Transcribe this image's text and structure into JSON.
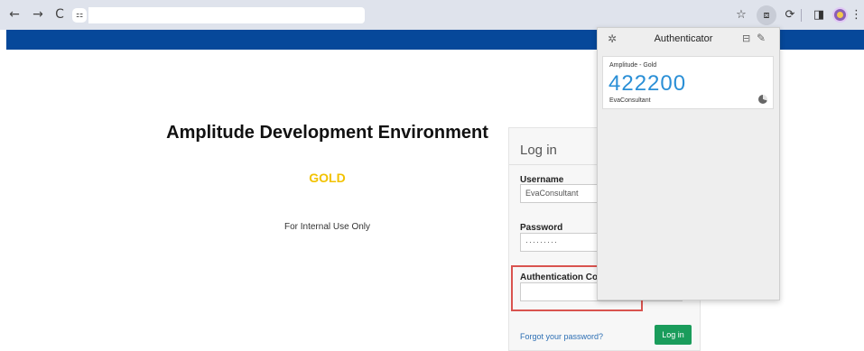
{
  "browser": {
    "back_icon": "←",
    "forward_icon": "→",
    "reload_icon": "C",
    "site_info_icon": "⚏",
    "bookmark_icon": "☆",
    "ext_icon": "⧈",
    "puzzle_icon": "⟳",
    "sidepanel_icon": "◨",
    "menu_icon": "⋮"
  },
  "page": {
    "title": "Amplitude Development Environment",
    "environment": "GOLD",
    "note": "For Internal Use Only"
  },
  "login": {
    "heading": "Log in",
    "username_label": "Username",
    "username_value": "EvaConsultant",
    "password_label": "Password",
    "password_value": "·········",
    "auth_code_label": "Authentication Code",
    "auth_code_value": "",
    "forgot_link": "Forgot your password?",
    "submit_label": "Log in"
  },
  "authenticator": {
    "title": "Authenticator",
    "gear_icon": "✲",
    "scan_icon": "⊟",
    "pencil_icon": "✎",
    "entry": {
      "issuer": "Amplitude - Gold",
      "code": "422200",
      "account": "EvaConsultant",
      "timer_remaining_fraction": 0.3
    }
  },
  "colors": {
    "header_blue": "#06489a",
    "gold": "#f2c200",
    "code_blue": "#2a8fd6",
    "login_green": "#1a9c5b",
    "highlight_red": "#d9534f"
  }
}
